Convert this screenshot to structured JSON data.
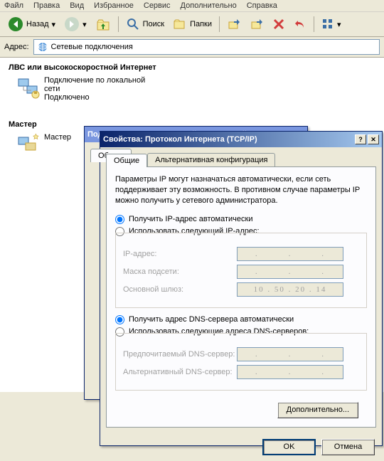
{
  "menubar": [
    "Файл",
    "Правка",
    "Вид",
    "Избранное",
    "Сервис",
    "Дополнительно",
    "Справка"
  ],
  "toolbar": {
    "back": "Назад",
    "search": "Поиск",
    "folders": "Папки"
  },
  "addressbar": {
    "label": "Адрес:",
    "value": "Сетевые подключения"
  },
  "content": {
    "section1_title": "ЛВС или высокоскоростной Интернет",
    "item1_line1": "Подключение по локальной",
    "item1_line2": "сети",
    "item1_line3": "Подключено",
    "section2_title": "Мастер",
    "item2": "Мастер"
  },
  "dialog_back": {
    "title": "Подключение по локальной сети — свойства",
    "tab1": "Общие"
  },
  "dialog": {
    "title": "Свойства: Протокол Интернета (TCP/IP)",
    "tab1": "Общие",
    "tab2": "Альтернативная конфигурация",
    "description": "Параметры IP могут назначаться автоматически, если сеть поддерживает эту возможность. В противном случае параметры IP можно получить у сетевого администратора.",
    "radio_ip_auto": "Получить IP-адрес автоматически",
    "radio_ip_manual": "Использовать следующий IP-адрес:",
    "label_ip": "IP-адрес:",
    "label_mask": "Маска подсети:",
    "label_gateway": "Основной шлюз:",
    "gateway_value": "10 . 50 . 20 . 14",
    "radio_dns_auto": "Получить адрес DNS-сервера автоматически",
    "radio_dns_manual": "Использовать следующие адреса DNS-серверов:",
    "label_dns1": "Предпочитаемый DNS-сервер:",
    "label_dns2": "Альтернативный DNS-сервер:",
    "btn_advanced": "Дополнительно...",
    "btn_ok": "OK",
    "btn_cancel": "Отмена"
  }
}
